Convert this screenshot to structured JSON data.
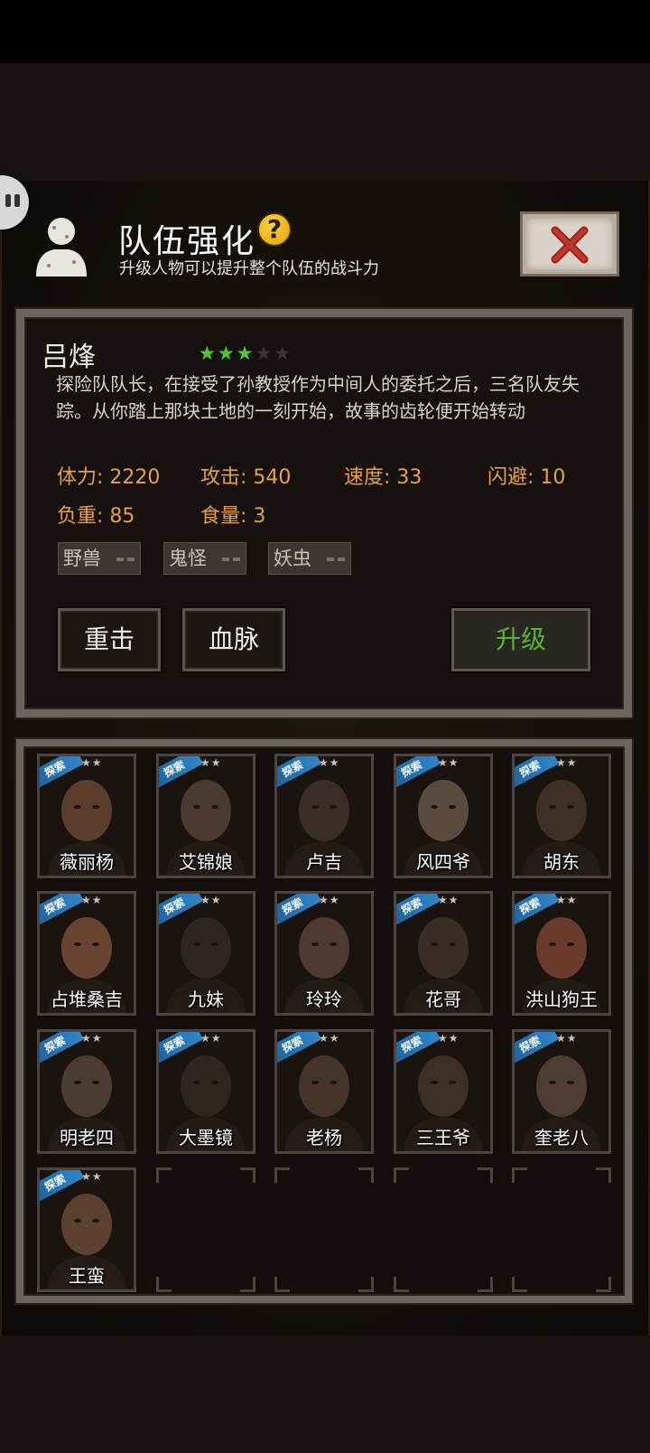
{
  "header": {
    "title": "队伍强化",
    "help_icon": "?",
    "subtitle": "升级人物可以提升整个队伍的战斗力",
    "close_icon": "close-x-icon"
  },
  "selected_hero": {
    "name": "吕烽",
    "stars_filled": 3,
    "stars_total": 5,
    "description": "探险队队长，在接受了孙教授作为中间人的委托之后，三名队友失踪。从你踏上那块土地的一刻开始，故事的齿轮便开始转动",
    "stats": {
      "hp": "体力: 2220",
      "attack": "攻击: 540",
      "speed": "速度: 33",
      "dodge": "闪避: 10",
      "load": "负重: 85",
      "food": "食量: 3"
    },
    "tags": [
      "野兽",
      "鬼怪",
      "妖虫"
    ],
    "buttons": {
      "skill1": "重击",
      "skill2": "血脉",
      "upgrade": "升级"
    }
  },
  "roster": {
    "badge_text": "探索",
    "mini_stars": "★★",
    "heroes": [
      {
        "name": "薇丽杨"
      },
      {
        "name": "艾锦娘"
      },
      {
        "name": "卢吉"
      },
      {
        "name": "风四爷"
      },
      {
        "name": "胡东"
      },
      {
        "name": "占堆桑吉"
      },
      {
        "name": "九妹"
      },
      {
        "name": "玲玲"
      },
      {
        "name": "花哥"
      },
      {
        "name": "洪山狗王"
      },
      {
        "name": "明老四"
      },
      {
        "name": "大墨镜"
      },
      {
        "name": "老杨"
      },
      {
        "name": "三王爷"
      },
      {
        "name": "奎老八"
      },
      {
        "name": "王蛮"
      }
    ],
    "empty_slots": 4
  },
  "colors": {
    "stat_orange": "#e9a23b",
    "upgrade_green": "#5ab42c",
    "star_green": "#56c23a"
  }
}
